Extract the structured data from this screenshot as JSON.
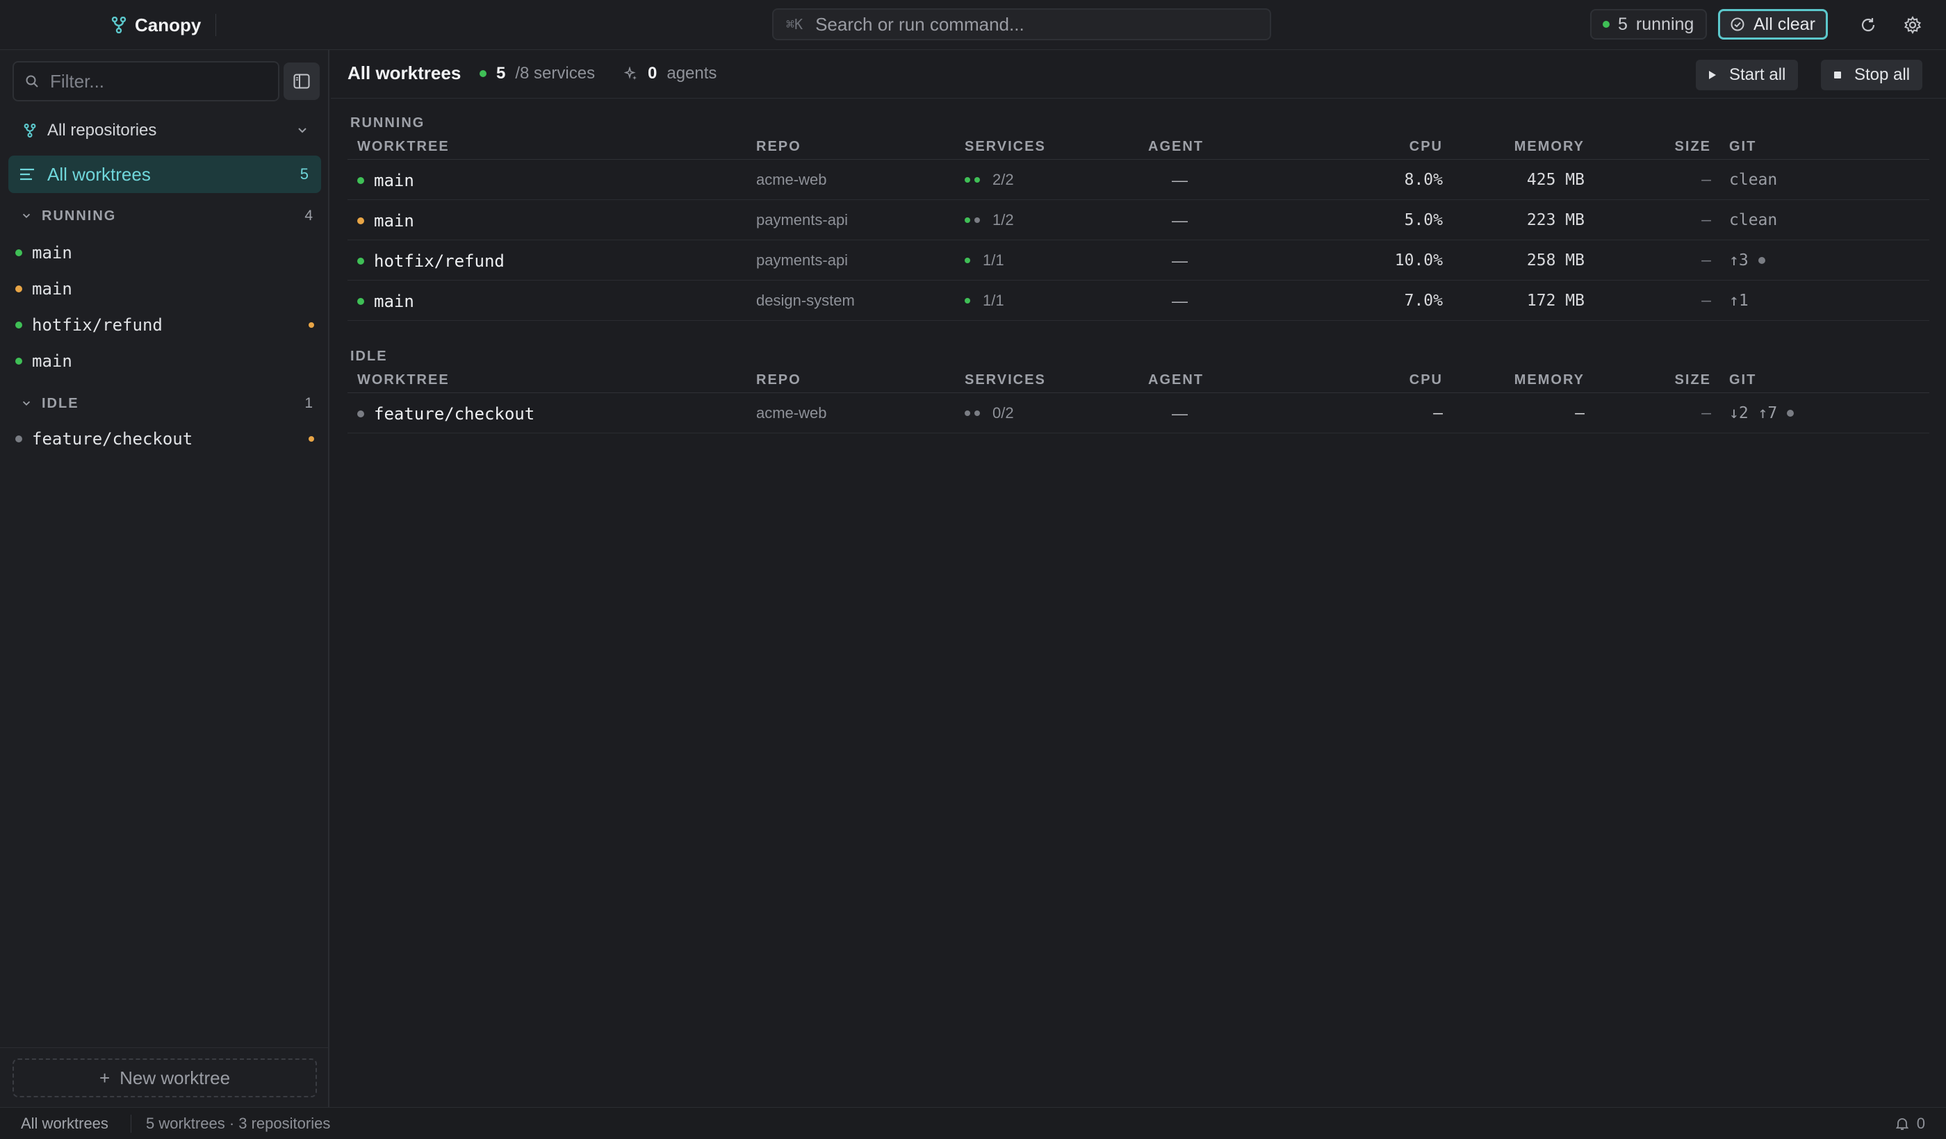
{
  "app": {
    "name": "Canopy"
  },
  "command": {
    "shortcut": "⌘K",
    "placeholder": "Search or run command..."
  },
  "status_pills": {
    "running_count": "5",
    "running_label": "running",
    "clear_label": "All clear"
  },
  "sidebar": {
    "filter_placeholder": "Filter...",
    "repo_select": "All repositories",
    "all_worktrees": {
      "label": "All worktrees",
      "count": "5"
    },
    "groups": [
      {
        "label": "RUNNING",
        "count": "4",
        "items": [
          {
            "name": "main",
            "status": "green",
            "flag": false
          },
          {
            "name": "main",
            "status": "amber",
            "flag": false
          },
          {
            "name": "hotfix/refund",
            "status": "green",
            "flag": true
          },
          {
            "name": "main",
            "status": "green",
            "flag": false
          }
        ]
      },
      {
        "label": "IDLE",
        "count": "1",
        "items": [
          {
            "name": "feature/checkout",
            "status": "grey",
            "flag": true
          }
        ]
      }
    ],
    "new_worktree": "New worktree"
  },
  "main": {
    "title": "All worktrees",
    "services_running": "5",
    "services_total": "/8 services",
    "agents_count": "0",
    "agents_label": "agents",
    "start_all": "Start all",
    "stop_all": "Stop all",
    "columns": [
      "WORKTREE",
      "REPO",
      "SERVICES",
      "AGENT",
      "CPU",
      "MEMORY",
      "SIZE",
      "GIT"
    ],
    "sections": [
      {
        "label": "RUNNING",
        "rows": [
          {
            "name": "main",
            "status": "green",
            "repo": "acme-web",
            "svc_dots": [
              "green",
              "green"
            ],
            "services": "2/2",
            "agent": "—",
            "cpu": "8.0%",
            "memory": "425 MB",
            "size": "–",
            "git": "clean",
            "git_dot": false
          },
          {
            "name": "main",
            "status": "amber",
            "repo": "payments-api",
            "svc_dots": [
              "green",
              "grey"
            ],
            "services": "1/2",
            "agent": "—",
            "cpu": "5.0%",
            "memory": "223 MB",
            "size": "–",
            "git": "clean",
            "git_dot": false
          },
          {
            "name": "hotfix/refund",
            "status": "green",
            "repo": "payments-api",
            "svc_dots": [
              "green"
            ],
            "services": "1/1",
            "agent": "—",
            "cpu": "10.0%",
            "memory": "258 MB",
            "size": "–",
            "git": "↑3",
            "git_dot": true
          },
          {
            "name": "main",
            "status": "green",
            "repo": "design-system",
            "svc_dots": [
              "green"
            ],
            "services": "1/1",
            "agent": "—",
            "cpu": "7.0%",
            "memory": "172 MB",
            "size": "–",
            "git": "↑1",
            "git_dot": false
          }
        ]
      },
      {
        "label": "IDLE",
        "rows": [
          {
            "name": "feature/checkout",
            "status": "grey",
            "repo": "acme-web",
            "svc_dots": [
              "grey",
              "grey"
            ],
            "services": "0/2",
            "agent": "—",
            "cpu": "–",
            "memory": "–",
            "size": "–",
            "git": "↓2 ↑7",
            "git_dot": true
          }
        ]
      }
    ]
  },
  "statusbar": {
    "left": "All worktrees",
    "summary": "5 worktrees · 3 repositories",
    "notifications": "0"
  },
  "colors": {
    "accent": "#5cc8cc",
    "green": "#3fbf56",
    "amber": "#e8a546",
    "grey": "#7a7d84"
  }
}
